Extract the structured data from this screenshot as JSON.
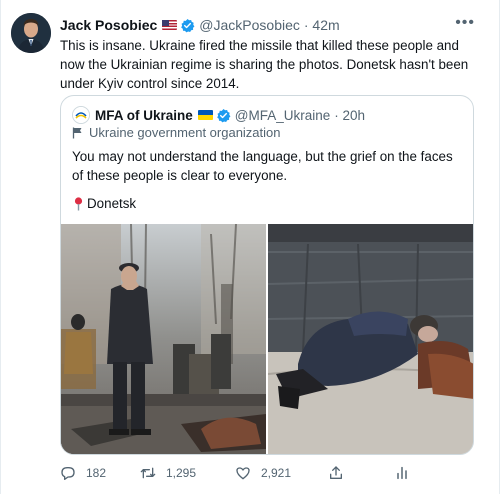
{
  "tweet": {
    "author_name": "Jack Posobiec",
    "author_handle": "@JackPosobiec",
    "time": "· 42m",
    "text": "This is insane. Ukraine fired the missile that killed these people and now the Ukrainian regime is sharing the photos. Donetsk hasn't been under Kyiv control since 2014."
  },
  "quote": {
    "author_name": "MFA of Ukraine",
    "author_handle": "@MFA_Ukraine",
    "time": "· 20h",
    "label": "Ukraine government organization",
    "text": "You may not understand the language, but the grief on the faces of these people is clear to everyone.",
    "location": "Donetsk"
  },
  "actions": {
    "replies": "182",
    "retweets": "1,295",
    "likes": "2,921"
  },
  "icons": [
    "more-icon",
    "verified-badge-icon",
    "us-flag-icon",
    "ukraine-flag-icon",
    "government-flag-icon",
    "pin-icon",
    "reply-icon",
    "retweet-icon",
    "like-icon",
    "share-icon",
    "analytics-icon"
  ],
  "colors": {
    "verified": "#1d9bf0",
    "secondary_text": "#536471",
    "pin": "#dd2e44"
  }
}
